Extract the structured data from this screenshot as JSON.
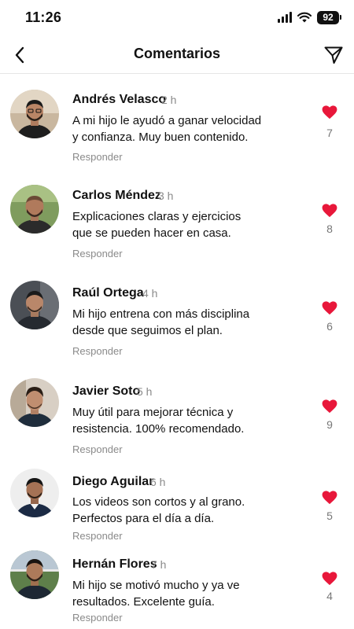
{
  "status_bar": {
    "time": "11:26",
    "battery": "92"
  },
  "header": {
    "title": "Comentarios"
  },
  "colors": {
    "like": "#e8173a",
    "muted": "#8a8a8a"
  },
  "icons": {
    "back": "chevron-left-icon",
    "send": "paper-plane-icon",
    "like": "heart-icon"
  },
  "comments": [
    {
      "name": "Andrés Velasco",
      "time": "2 h",
      "line1": "A mi hijo le ayudó a ganar velocidad",
      "line2": "y confianza. Muy buen contenido.",
      "reply": "Responder",
      "likes": "7"
    },
    {
      "name": "Carlos Méndez",
      "time": "3 h",
      "line1": "Explicaciones claras y ejercicios",
      "line2": "que se pueden hacer en casa.",
      "reply": "Responder",
      "likes": "8"
    },
    {
      "name": "Raúl Ortega",
      "time": "4 h",
      "line1": "Mi hijo entrena con más disciplina",
      "line2": "desde que seguimos el plan.",
      "reply": "Responder",
      "likes": "6"
    },
    {
      "name": "Javier Soto",
      "time": "5 h",
      "line1": "Muy útil para mejorar técnica y",
      "line2": "resistencia. 100% recomendado.",
      "reply": "Responder",
      "likes": "9"
    },
    {
      "name": "Diego Aguilar",
      "time": "6 h",
      "line1": "Los videos son cortos y al grano.",
      "line2": "Perfectos para el día a día.",
      "reply": "Responder",
      "likes": "5"
    },
    {
      "name": "Hernán Flores",
      "time": "7 h",
      "line1": "Mi hijo se motivó mucho y ya ve",
      "line2": "resultados. Excelente guía.",
      "reply": "Responder",
      "likes": "4"
    }
  ]
}
